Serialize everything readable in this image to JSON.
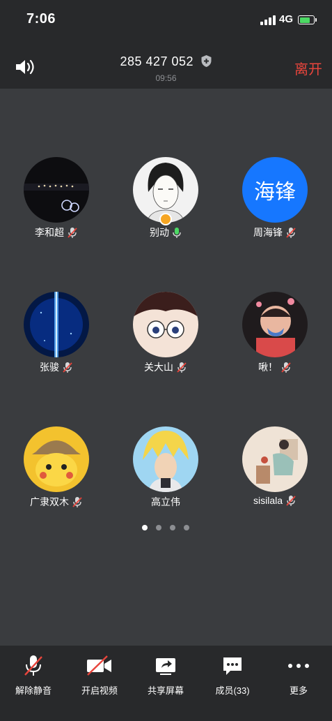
{
  "status_bar": {
    "time": "7:06",
    "network": "4G"
  },
  "header": {
    "meeting_id": "285 427 052",
    "duration": "09:56",
    "leave_label": "离开"
  },
  "participants": [
    {
      "name": "李和超",
      "mic": "muted"
    },
    {
      "name": "别动",
      "mic": "active",
      "host": true
    },
    {
      "name": "周海锋",
      "mic": "muted",
      "avatar_text": "海锋"
    },
    {
      "name": "张骏",
      "mic": "muted"
    },
    {
      "name": "关大山",
      "mic": "muted"
    },
    {
      "name": "啾！",
      "mic": "muted"
    },
    {
      "name": "广隶双木",
      "mic": "muted"
    },
    {
      "name": "高立伟",
      "mic": "none"
    },
    {
      "name": "sisilala",
      "mic": "muted"
    }
  ],
  "pagination": {
    "total": 4,
    "current": 1
  },
  "toolbar": {
    "unmute_label": "解除静音",
    "video_label": "开启视频",
    "share_label": "共享屏幕",
    "members_label": "成员(33)",
    "more_label": "更多"
  },
  "colors": {
    "leave": "#e8453c",
    "mic_active": "#4cd964",
    "mic_muted": "#e8453c",
    "accent_blue": "#1677ff",
    "host_badge": "#f6a623"
  }
}
